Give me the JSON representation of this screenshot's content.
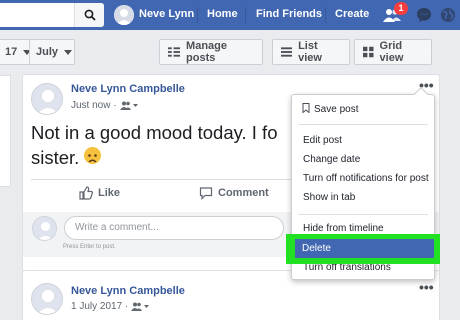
{
  "colors": {
    "brand": "#4267b2",
    "highlight": "#22e022",
    "selected": "#4267b2"
  },
  "topbar": {
    "search_icon": "search-icon",
    "user_name": "Neve Lynn",
    "home": "Home",
    "find_friends": "Find Friends",
    "create": "Create",
    "friend_requests_badge": "1"
  },
  "filters": {
    "year_value": "17",
    "month_value": "July"
  },
  "toolbar": {
    "manage_posts": "Manage posts",
    "list_view": "List view",
    "grid_view": "Grid view"
  },
  "post1": {
    "author": "Neve Lynn Campbelle",
    "timestamp": "Just now ·",
    "text": "Not in a good mood today. I fo",
    "text_line2": "sister. ",
    "like": "Like",
    "comment": "Comment",
    "comment_placeholder": "Write a comment...",
    "comment_hint": "Press Enter to post."
  },
  "post2": {
    "author": "Neve Lynn Campbelle",
    "timestamp": "1 July 2017 ·"
  },
  "menu": {
    "items": [
      "Save post",
      "Edit post",
      "Change date",
      "Turn off notifications for post",
      "Show in tab",
      "Hide from timeline",
      "Delete",
      "Turn off translations"
    ],
    "selected": "Delete"
  }
}
